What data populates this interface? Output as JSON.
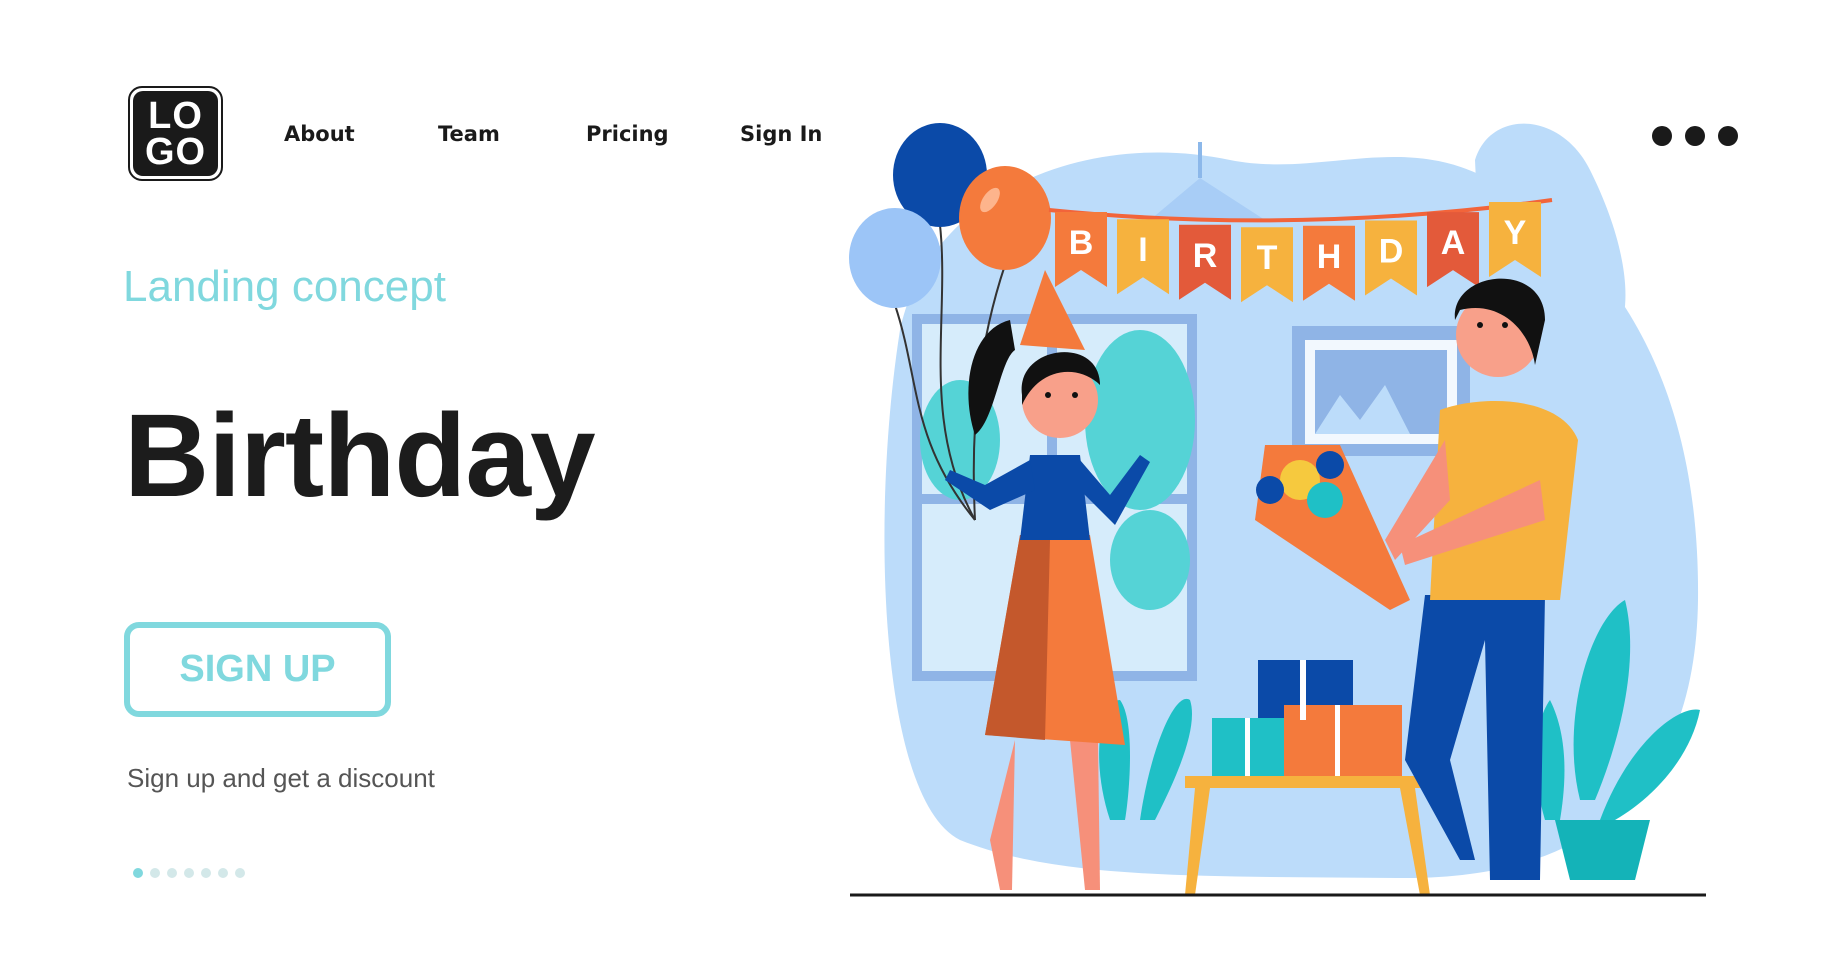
{
  "header": {
    "logo_text": [
      "LO",
      "GO"
    ],
    "nav": [
      {
        "label": "About"
      },
      {
        "label": "Team"
      },
      {
        "label": "Pricing"
      },
      {
        "label": "Sign In"
      }
    ],
    "more_icon": "three-dots-horizontal"
  },
  "hero": {
    "kicker": "Landing concept",
    "title": "Birthday",
    "cta_label": "SIGN UP",
    "subtext": "Sign up and get a discount",
    "pager": {
      "count": 7,
      "active_index": 0
    }
  },
  "illustration": {
    "banner_text": "BIRTHDAY",
    "colors": {
      "accent": "#80d8de",
      "blob": "#bcdcfa",
      "orange": "#f47a3c",
      "blue": "#0a4cb0",
      "yellow": "#f6b23e",
      "teal": "#1fc0c6"
    }
  }
}
